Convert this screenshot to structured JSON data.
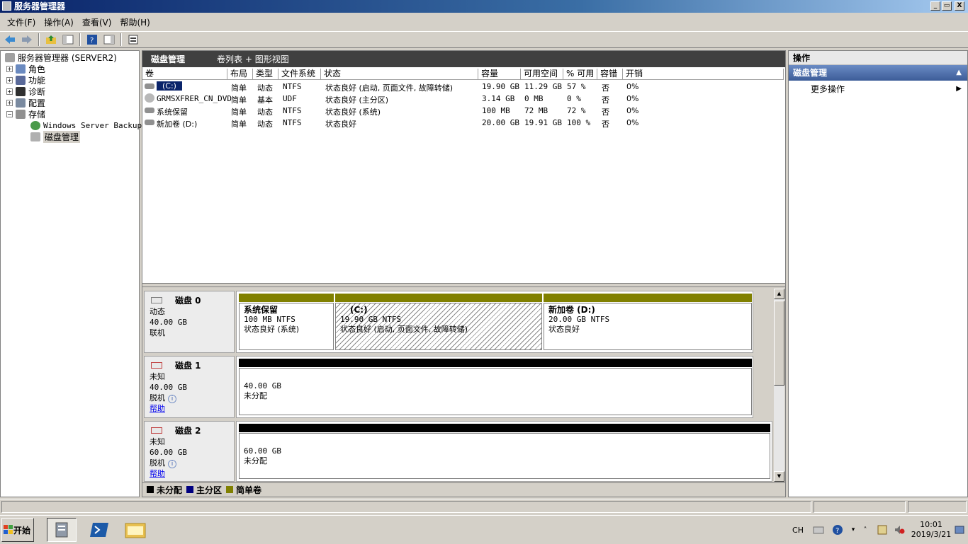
{
  "window": {
    "title": "服务器管理器",
    "min": "_",
    "max": "▭",
    "close": "X"
  },
  "menu": [
    "文件(F)",
    "操作(A)",
    "查看(V)",
    "帮助(H)"
  ],
  "tree": {
    "root": "服务器管理器 (SERVER2)",
    "items": [
      "角色",
      "功能",
      "诊断",
      "配置",
      "存储"
    ],
    "storage_children": [
      "Windows Server Backup",
      "磁盘管理"
    ]
  },
  "center": {
    "title": "磁盘管理",
    "view_label": "卷列表 + 图形视图",
    "columns": [
      "卷",
      "布局",
      "类型",
      "文件系统",
      "状态",
      "容量",
      "可用空间",
      "% 可用",
      "容错",
      "开销"
    ],
    "rows": [
      {
        "vol": "(C:)",
        "layout": "简单",
        "type": "动态",
        "fs": "NTFS",
        "status": "状态良好 (启动, 页面文件, 故障转储)",
        "cap": "19.90 GB",
        "free": "11.29 GB",
        "pct": "57 %",
        "ft": "否",
        "ovh": "0%"
      },
      {
        "vol": "GRMSXFRER_CN_DVD",
        "layout": "简单",
        "type": "基本",
        "fs": "UDF",
        "status": "状态良好 (主分区)",
        "cap": "3.14 GB",
        "free": "0 MB",
        "pct": "0 %",
        "ft": "否",
        "ovh": "0%"
      },
      {
        "vol": "系统保留",
        "layout": "简单",
        "type": "动态",
        "fs": "NTFS",
        "status": "状态良好 (系统)",
        "cap": "100 MB",
        "free": "72 MB",
        "pct": "72 %",
        "ft": "否",
        "ovh": "0%"
      },
      {
        "vol": "新加卷 (D:)",
        "layout": "简单",
        "type": "动态",
        "fs": "NTFS",
        "status": "状态良好",
        "cap": "20.00 GB",
        "free": "19.91 GB",
        "pct": "100 %",
        "ft": "否",
        "ovh": "0%"
      }
    ]
  },
  "disks": [
    {
      "name": "磁盘 0",
      "kind": "动态",
      "size": "40.00 GB",
      "state": "联机",
      "parts": [
        {
          "name": "系统保留",
          "size": "100 MB NTFS",
          "status": "状态良好 (系统)"
        },
        {
          "name": "(C:)",
          "size": "19.90 GB NTFS",
          "status": "状态良好 (启动, 页面文件, 故障转储)"
        },
        {
          "name": "新加卷  (D:)",
          "size": "20.00 GB NTFS",
          "status": "状态良好"
        }
      ]
    },
    {
      "name": "磁盘 1",
      "kind": "未知",
      "size": "40.00 GB",
      "state": "脱机",
      "help": "帮助",
      "parts": [
        {
          "size": "40.00 GB",
          "status": "未分配"
        }
      ]
    },
    {
      "name": "磁盘 2",
      "kind": "未知",
      "size": "60.00 GB",
      "state": "脱机",
      "help": "帮助",
      "parts": [
        {
          "size": "60.00 GB",
          "status": "未分配"
        }
      ]
    }
  ],
  "legend": [
    "未分配",
    "主分区",
    "简单卷"
  ],
  "colors": {
    "unallocated": "#000000",
    "primary": "#000080",
    "simple": "#808000",
    "title_bar": "#0a246a"
  },
  "actions": {
    "header": "操作",
    "section": "磁盘管理",
    "more": "更多操作"
  },
  "taskbar": {
    "start": "开始",
    "lang": "CH",
    "time": "10:01",
    "date": "2019/3/21"
  }
}
